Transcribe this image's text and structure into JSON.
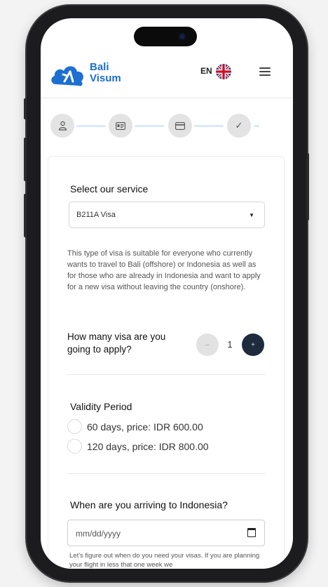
{
  "header": {
    "brand_line1": "Bali",
    "brand_line2": "Visum",
    "lang_code": "EN",
    "flag": "uk-flag-icon",
    "menu": "hamburger-icon"
  },
  "steps": [
    {
      "icon": "user-icon"
    },
    {
      "icon": "id-card-icon"
    },
    {
      "icon": "payment-card-icon"
    },
    {
      "icon": "check-icon",
      "glyph": "✓"
    }
  ],
  "form": {
    "service_title": "Select our service",
    "service_selected": "B211A Visa",
    "service_description": "This type of visa is suitable for everyone who currently wants to travel to Bali (offshore) or Indonesia as well as for those who are already in Indonesia and want to apply for a new visa without leaving the country (onshore).",
    "quantity_label": "How many visa are you going to apply?",
    "quantity_value": "1",
    "minus_glyph": "–",
    "plus_glyph": "+",
    "validity_title": "Validity Period",
    "validity_options": [
      {
        "label": "60 days, price: IDR 600.00"
      },
      {
        "label": "120 days, price: IDR 800.00"
      }
    ],
    "arrival_title": "When are you arriving to Indonesia?",
    "arrival_placeholder": "mm/dd/yyyy",
    "arrival_hint": "Let's figure out when do you need your visas. If you are planning your flight in less that one week we"
  },
  "colors": {
    "brand_blue": "#1d6fd1",
    "plus_button": "#1e2b3d",
    "step_line": "#dbe8fb"
  }
}
